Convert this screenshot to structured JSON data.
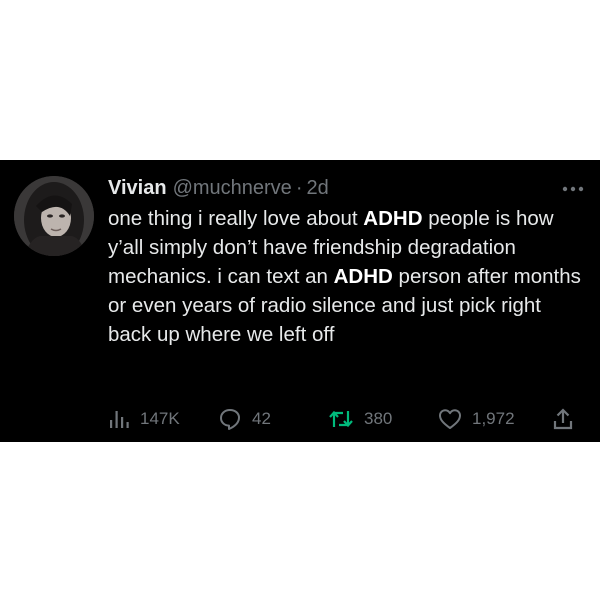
{
  "tweet": {
    "author": {
      "display_name": "Vivian",
      "handle": "@muchnerve",
      "separator": "·",
      "time": "2d",
      "avatar_icon": "profile-photo"
    },
    "text_segments": [
      "one thing i really love about ",
      "ADHD",
      " people is how y’all simply don’t have friendship degradation mechanics. i can text an ",
      "ADHD",
      " person after months or even years of radio silence and just pick right back up where we left off"
    ],
    "stats": {
      "views": "147K",
      "replies": "42",
      "retweets": "380",
      "likes": "1,972"
    },
    "icons": {
      "more": "more-icon",
      "views": "views-icon",
      "reply": "reply-icon",
      "retweet": "retweet-icon",
      "like": "heart-icon",
      "share": "share-icon"
    },
    "colors": {
      "background": "#000000",
      "text": "#e7e9ea",
      "muted": "#71767b",
      "retweet_accent": "#00ba7c"
    }
  }
}
